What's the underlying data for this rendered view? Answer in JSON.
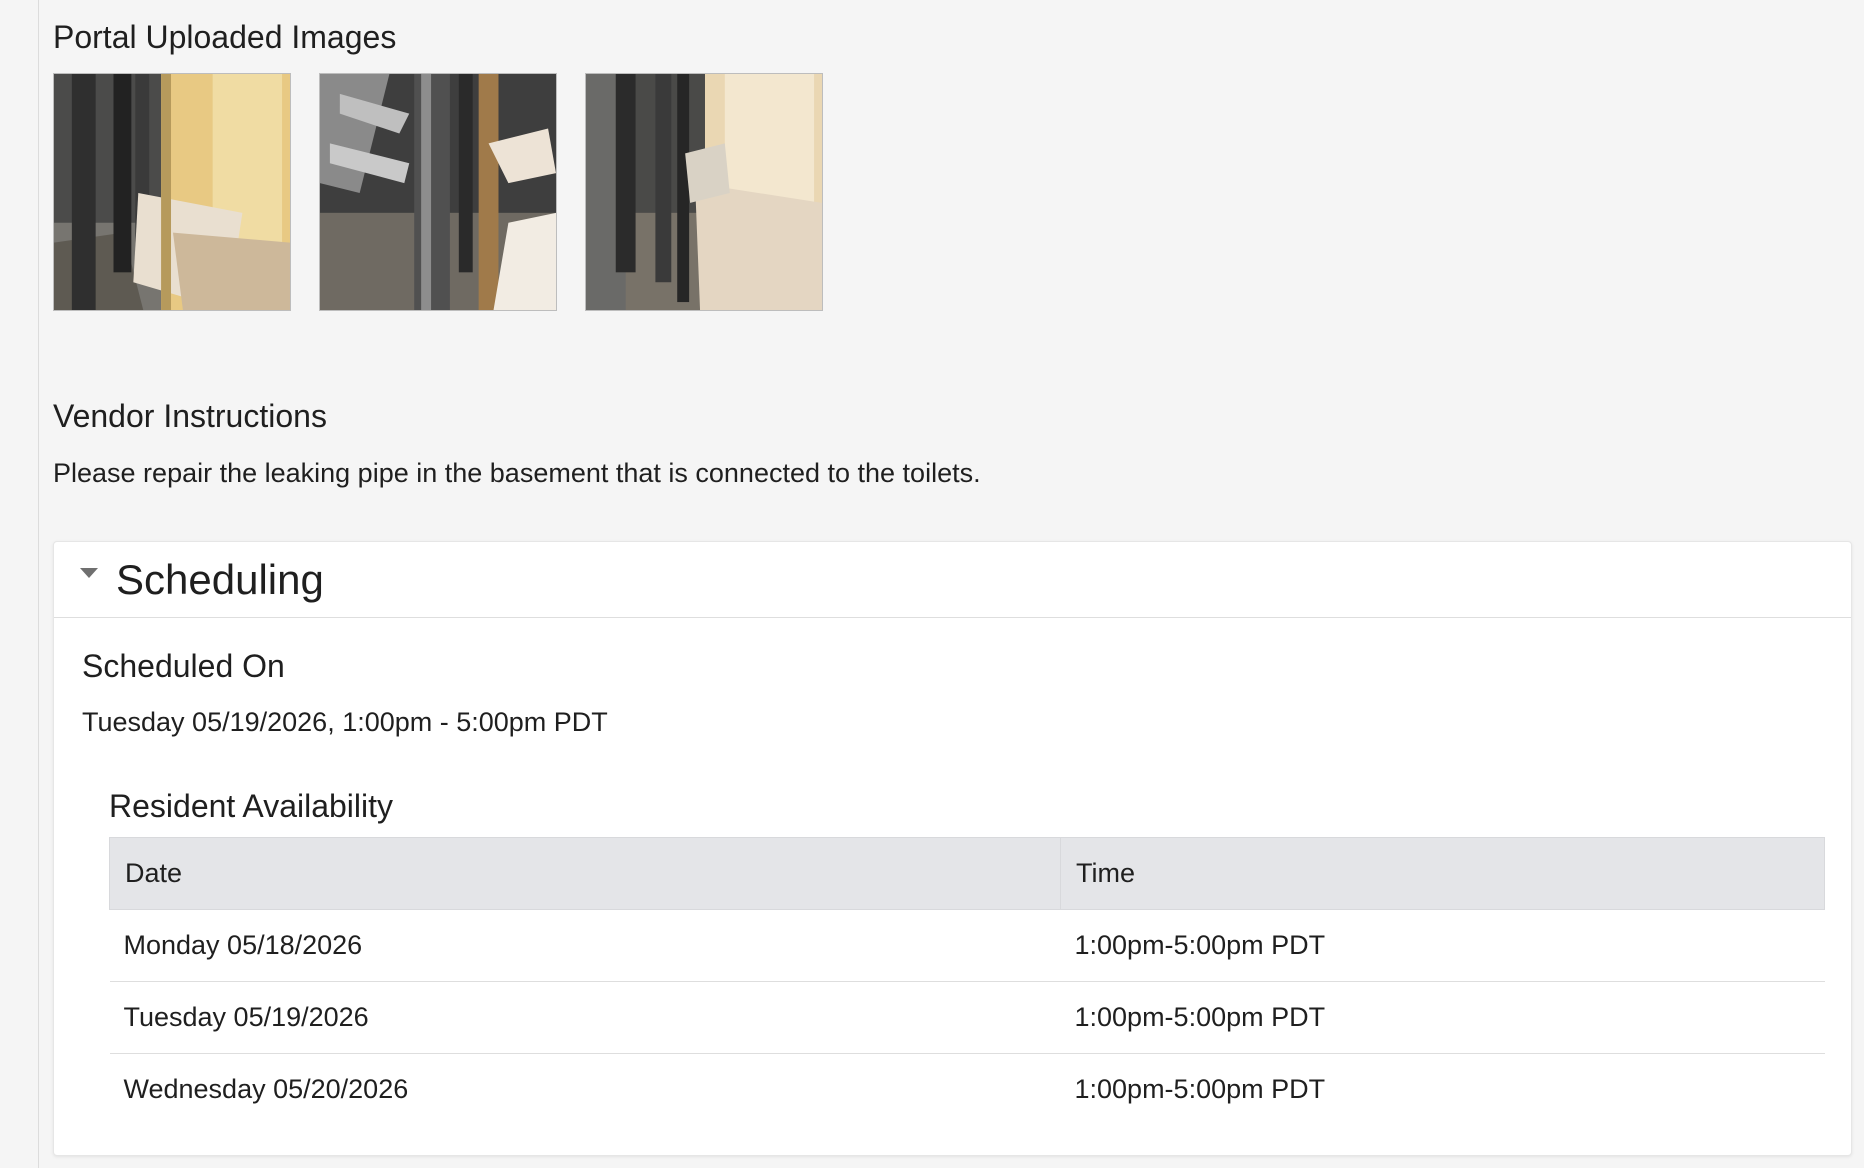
{
  "images_section": {
    "title": "Portal Uploaded Images",
    "images": [
      {
        "alt": "basement pipe photo 1"
      },
      {
        "alt": "basement pipe photo 2"
      },
      {
        "alt": "basement pipe photo 3"
      }
    ]
  },
  "vendor": {
    "title": "Vendor Instructions",
    "text": "Please repair the leaking pipe in the basement that is connected to the toilets."
  },
  "scheduling": {
    "title": "Scheduling",
    "expanded": true,
    "scheduled_on_label": "Scheduled On",
    "scheduled_on_value": "Tuesday 05/19/2026, 1:00pm - 5:00pm PDT",
    "availability": {
      "title": "Resident Availability",
      "columns": [
        "Date",
        "Time"
      ],
      "rows": [
        {
          "date": "Monday 05/18/2026",
          "time": "1:00pm-5:00pm PDT"
        },
        {
          "date": "Tuesday 05/19/2026",
          "time": "1:00pm-5:00pm PDT"
        },
        {
          "date": "Wednesday 05/20/2026",
          "time": "1:00pm-5:00pm PDT"
        }
      ]
    }
  },
  "colors": {
    "page_background": "#f5f5f5",
    "card_background": "#ffffff",
    "table_header_background": "#e4e5e8",
    "text": "#1f1f1f"
  }
}
